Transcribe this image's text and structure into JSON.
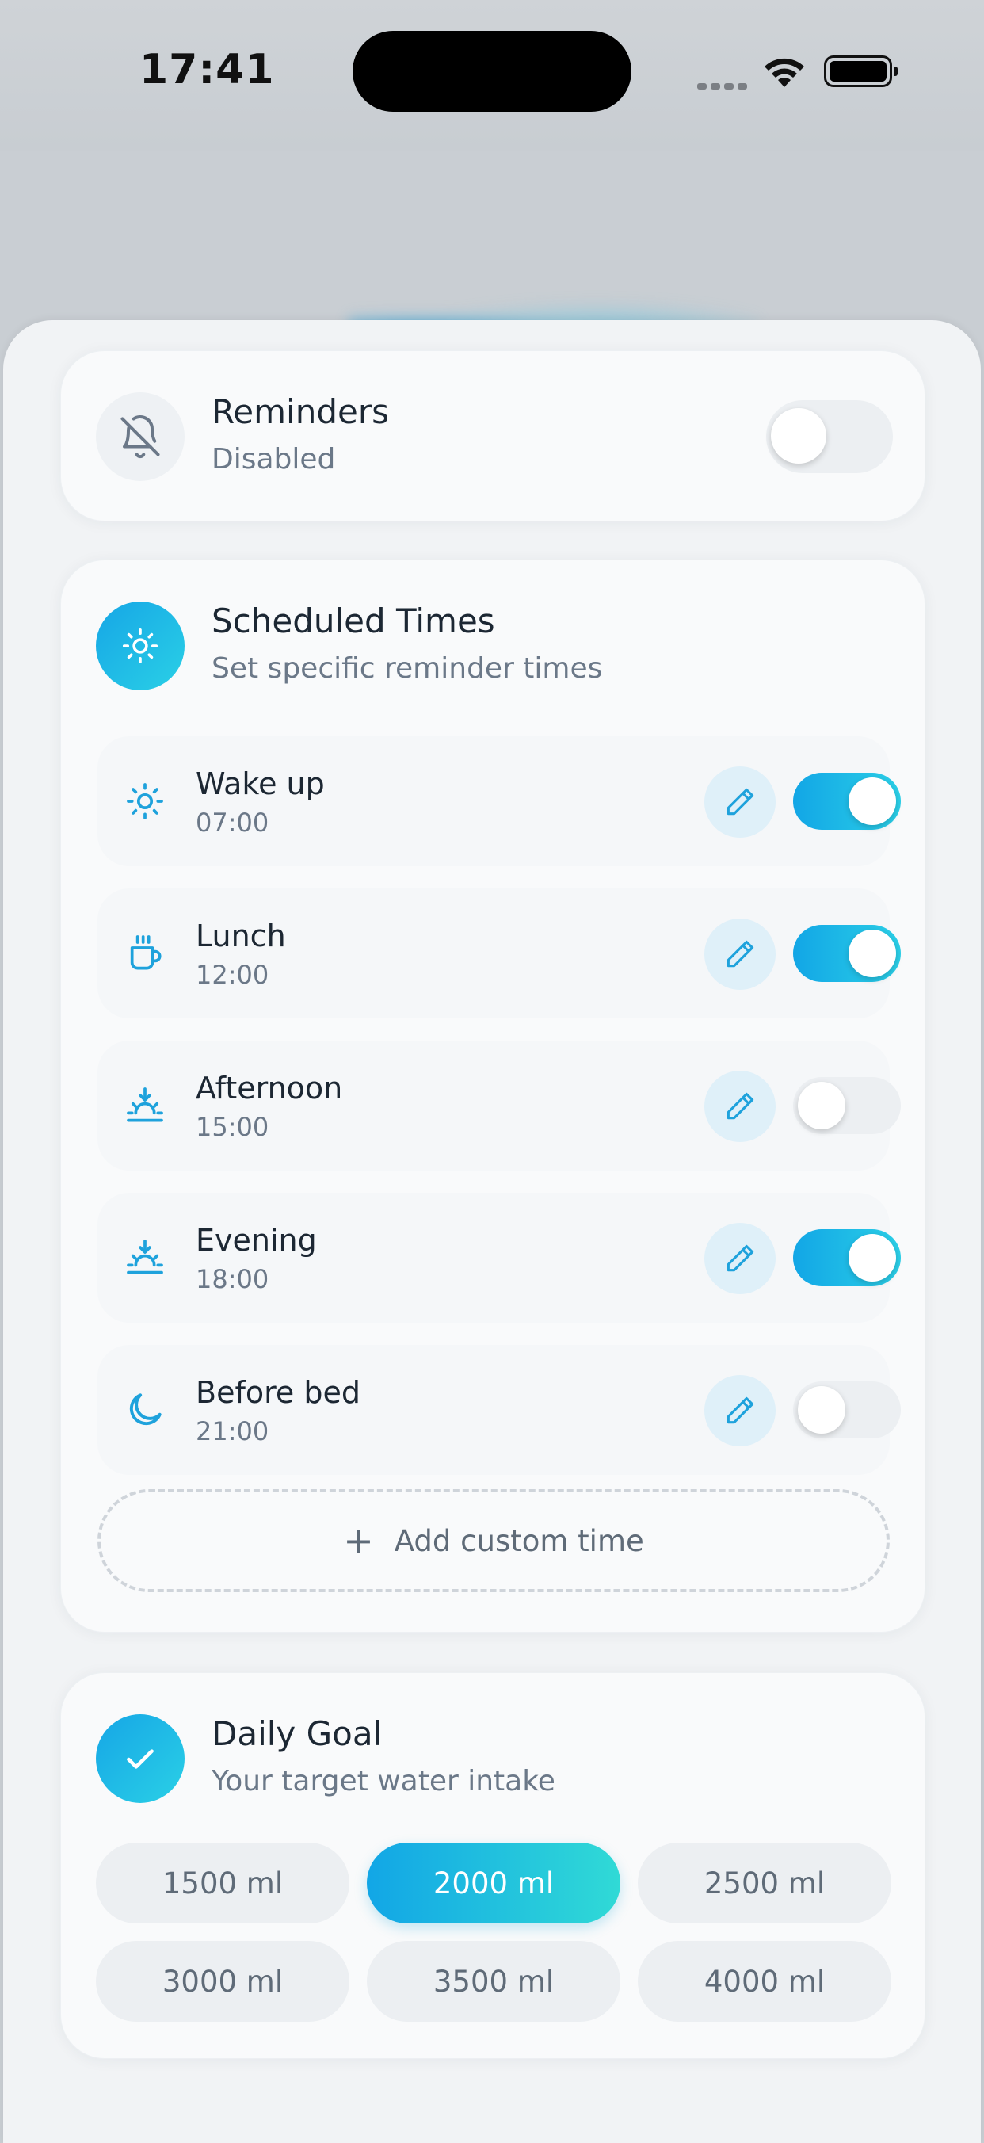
{
  "status_bar": {
    "time": "17:41"
  },
  "reminders": {
    "title": "Reminders",
    "status": "Disabled",
    "enabled": false
  },
  "scheduled": {
    "title": "Scheduled Times",
    "subtitle": "Set specific reminder times",
    "items": [
      {
        "label": "Wake up",
        "time": "07:00",
        "icon": "sun-icon",
        "enabled": true
      },
      {
        "label": "Lunch",
        "time": "12:00",
        "icon": "coffee-cup-icon",
        "enabled": true
      },
      {
        "label": "Afternoon",
        "time": "15:00",
        "icon": "sunset-icon",
        "enabled": false
      },
      {
        "label": "Evening",
        "time": "18:00",
        "icon": "sunset-icon",
        "enabled": true
      },
      {
        "label": "Before bed",
        "time": "21:00",
        "icon": "moon-icon",
        "enabled": false
      }
    ],
    "add_label": "Add custom time"
  },
  "goal": {
    "title": "Daily Goal",
    "subtitle": "Your target water intake",
    "options": [
      "1500 ml",
      "2000 ml",
      "2500 ml",
      "3000 ml",
      "3500 ml",
      "4000 ml"
    ],
    "selected": "2000 ml"
  },
  "colors": {
    "accent": "#12a6e6",
    "accent_end": "#2bcfe7",
    "text_primary": "#1c2733",
    "text_secondary": "#6b7888"
  }
}
